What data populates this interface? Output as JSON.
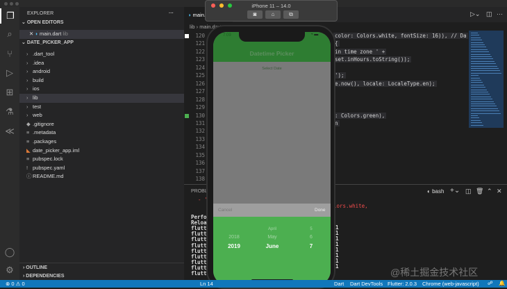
{
  "sidebar": {
    "title": "EXPLORER",
    "more": "···",
    "open_editors": "OPEN EDITORS",
    "open_file": "main.dart",
    "open_file_dir": "lib",
    "project": "DATE_PICKER_APP",
    "items": [
      {
        "label": ".dart_tool",
        "type": "folder"
      },
      {
        "label": ".idea",
        "type": "folder"
      },
      {
        "label": "android",
        "type": "folder"
      },
      {
        "label": "build",
        "type": "folder"
      },
      {
        "label": "ios",
        "type": "folder"
      },
      {
        "label": "lib",
        "type": "folder"
      },
      {
        "label": "test",
        "type": "folder"
      },
      {
        "label": "web",
        "type": "folder"
      },
      {
        "label": ".gitignore",
        "type": "file"
      },
      {
        "label": ".metadata",
        "type": "file"
      },
      {
        "label": ".packages",
        "type": "file"
      },
      {
        "label": "date_picker_app.iml",
        "type": "file"
      },
      {
        "label": "pubspec.lock",
        "type": "file"
      },
      {
        "label": "pubspec.yaml",
        "type": "file"
      },
      {
        "label": "README.md",
        "type": "file"
      }
    ],
    "outline": "OUTLINE",
    "dependencies": "DEPENDENCIES"
  },
  "editor": {
    "tab": "main.dart",
    "breadcrumb": [
      "lib",
      "main.dart"
    ],
    "line_numbers": [
      "120",
      "121",
      "122",
      "123",
      "124",
      "125",
      "126",
      "127",
      "128",
      "129",
      "130",
      "131",
      "132",
      "133",
      "134",
      "135",
      "136",
      "137",
      "138"
    ],
    "code": [
      [
        "120",
        "color: Colors.white, fontSize: 16)), // Da"
      ],
      [
        "121",
        "{"
      ],
      [
        "122",
        "in time zone ' +"
      ],
      [
        "123",
        "set.inHours.toString());"
      ],
      [
        "125",
        "');"
      ],
      [
        "126",
        "e.now(), locale: LocaleType.en);"
      ],
      [
        "130",
        ": Colors.green),"
      ],
      [
        "131",
        "n"
      ]
    ]
  },
  "panel": {
    "tab": "PROBL",
    "shell": "bash",
    "error": "- 'Co",
    "error_tail": "lors.white,",
    "lines": [
      "Perfor",
      "Reload",
      "flutte",
      "flutte",
      "flutte",
      "flutte",
      "flutte",
      "flutte",
      "flutte",
      "flutte",
      "flutte"
    ],
    "counts": [
      "1",
      "1",
      "1",
      "1",
      "1",
      "1",
      "1",
      "1"
    ]
  },
  "simulator": {
    "title": "iPhone 11 – 14.0",
    "time": "7:09",
    "app_title": "Datetime Picker",
    "select_date": "Select Date",
    "cancel": "Cancel",
    "done": "Done",
    "years": [
      "2018",
      "2019"
    ],
    "months": [
      "April",
      "May",
      "June"
    ],
    "days": [
      "5",
      "6",
      "7"
    ],
    "selected": {
      "year": "2019",
      "month": "June",
      "day": "7"
    }
  },
  "status": {
    "errors": "0",
    "warnings": "0",
    "position": "Ln 14",
    "dart": "Dart",
    "devtools": "Dart DevTools",
    "flutter": "Flutter: 2.0.3",
    "device": "Chrome (web-javascript)"
  },
  "watermark": "@稀土掘金技术社区",
  "colors": {
    "app_green": "#2e7d32",
    "picker_green": "#4caf50",
    "status_blue": "#1177bb"
  }
}
